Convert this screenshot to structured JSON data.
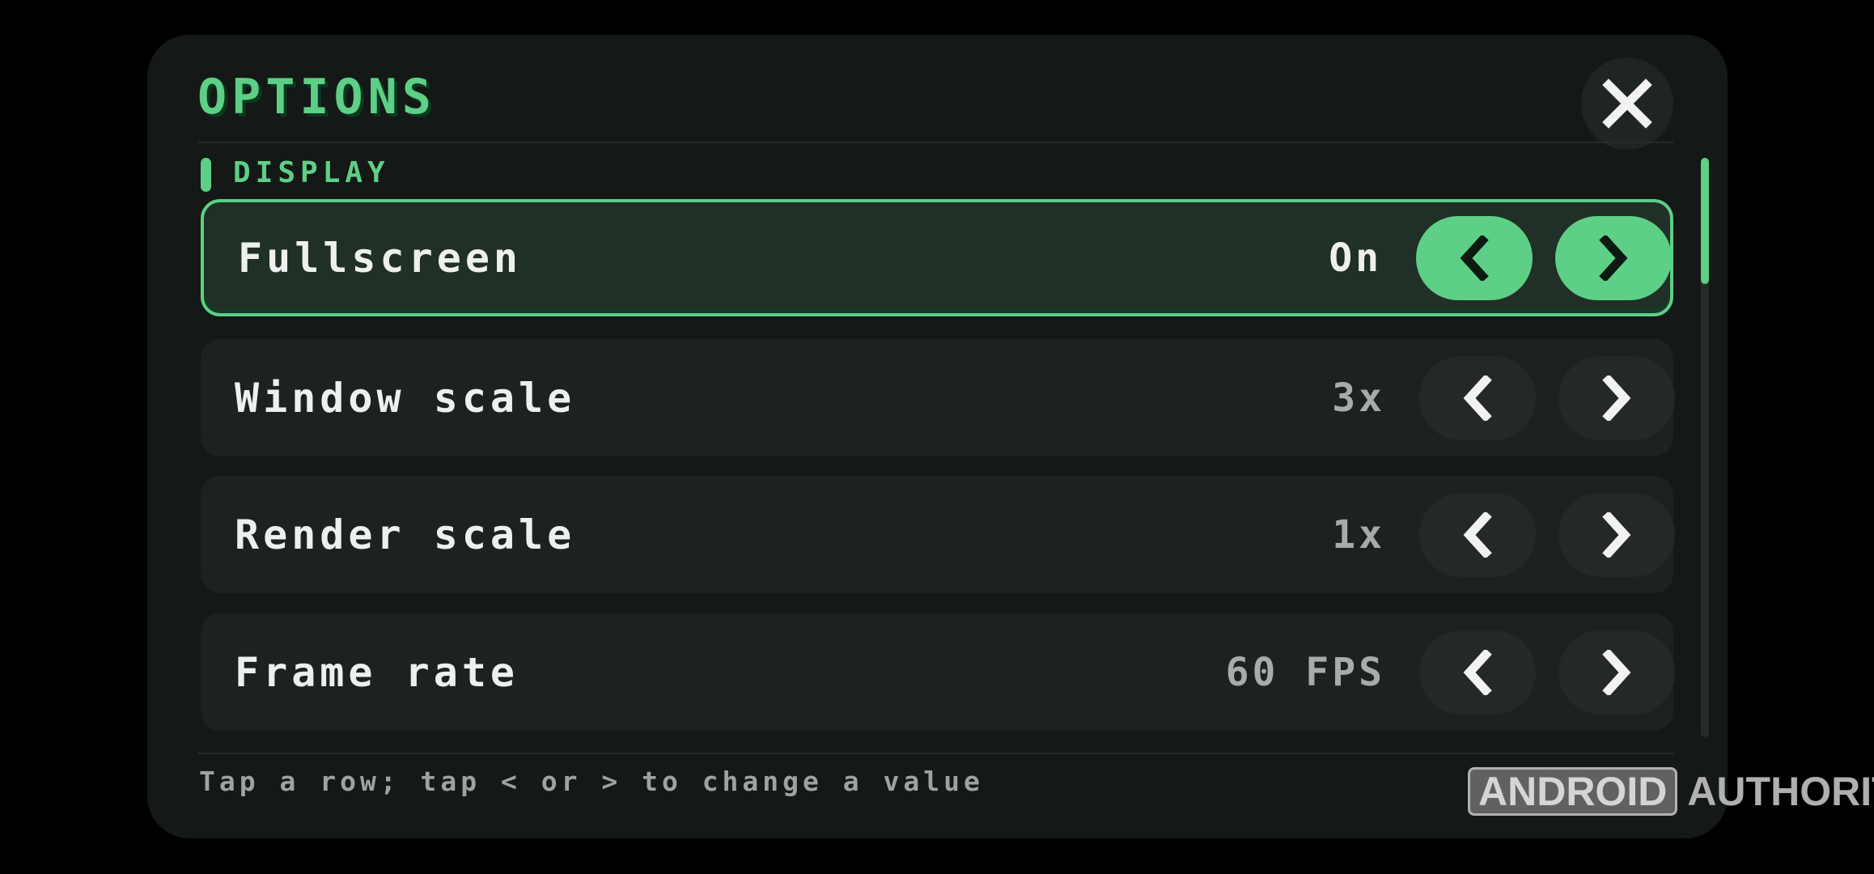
{
  "header": {
    "title": "OPTIONS",
    "close_icon": "close-x-icon"
  },
  "section": {
    "label": "DISPLAY"
  },
  "rows": [
    {
      "label": "Fullscreen",
      "value": "On",
      "selected": true
    },
    {
      "label": "Window scale",
      "value": "3x",
      "selected": false
    },
    {
      "label": "Render scale",
      "value": "1x",
      "selected": false
    },
    {
      "label": "Frame rate",
      "value": "60 FPS",
      "selected": false
    }
  ],
  "controls": {
    "prev_icon": "chevron-left-icon",
    "next_icon": "chevron-right-icon"
  },
  "footer": {
    "hint": "Tap a row; tap < or > to change a value"
  },
  "watermark": {
    "boxed": "ANDROID",
    "plain": "AUTHORITY"
  },
  "colors": {
    "accent": "#5ecf86",
    "panel": "#141816",
    "row": "#1d221f",
    "row_selected": "#203026",
    "background": "#000000"
  }
}
